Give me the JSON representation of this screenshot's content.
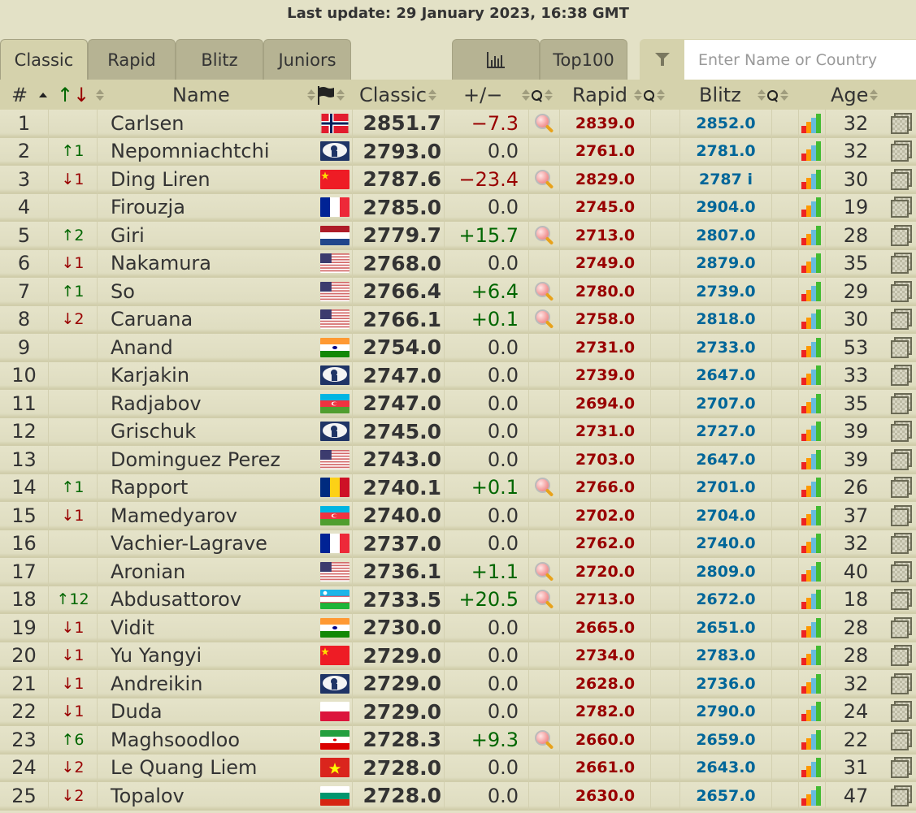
{
  "header": {
    "last_update": "Last update: 29 January 2023, 16:38 GMT"
  },
  "tabs": [
    {
      "label": "Classic",
      "active": true
    },
    {
      "label": "Rapid",
      "active": false
    },
    {
      "label": "Blitz",
      "active": false
    },
    {
      "label": "Juniors",
      "active": false
    }
  ],
  "right_tabs": {
    "chart_icon": "bar-chart-icon",
    "top100_label": "Top100"
  },
  "search": {
    "placeholder": "Enter Name or Country",
    "value": "",
    "icon": "filter-icon"
  },
  "columns": {
    "rank": "#",
    "change": "↑↓",
    "name": "Name",
    "flag_icon": "flag-icon",
    "classic": "Classic",
    "diff": "+/−",
    "rapid": "Rapid",
    "blitz": "Blitz",
    "age": "Age"
  },
  "colors": {
    "rapid": "#990000",
    "blitz": "#006699",
    "up": "#006600",
    "down": "#990000"
  },
  "players": [
    {
      "rank": "1",
      "change": "",
      "dir": "",
      "name": "Carlsen",
      "country": "Norway",
      "classic": "2851.7",
      "diff": "−7.3",
      "sign": "neg",
      "rapid": "2839.0",
      "blitz": "2852.0",
      "age": "32"
    },
    {
      "rank": "2",
      "change": "↑1",
      "dir": "up",
      "name": "Nepomniachtchi",
      "country": "FIDE",
      "classic": "2793.0",
      "diff": "0.0",
      "sign": "zero",
      "rapid": "2761.0",
      "blitz": "2781.0",
      "age": "32"
    },
    {
      "rank": "3",
      "change": "↓1",
      "dir": "down",
      "name": "Ding Liren",
      "country": "China",
      "classic": "2787.6",
      "diff": "−23.4",
      "sign": "neg",
      "rapid": "2829.0",
      "blitz": "2787 i",
      "age": "30"
    },
    {
      "rank": "4",
      "change": "",
      "dir": "",
      "name": "Firouzja",
      "country": "France",
      "classic": "2785.0",
      "diff": "0.0",
      "sign": "zero",
      "rapid": "2745.0",
      "blitz": "2904.0",
      "age": "19"
    },
    {
      "rank": "5",
      "change": "↑2",
      "dir": "up",
      "name": "Giri",
      "country": "Netherlands",
      "classic": "2779.7",
      "diff": "+15.7",
      "sign": "pos",
      "rapid": "2713.0",
      "blitz": "2807.0",
      "age": "28"
    },
    {
      "rank": "6",
      "change": "↓1",
      "dir": "down",
      "name": "Nakamura",
      "country": "USA",
      "classic": "2768.0",
      "diff": "0.0",
      "sign": "zero",
      "rapid": "2749.0",
      "blitz": "2879.0",
      "age": "35"
    },
    {
      "rank": "7",
      "change": "↑1",
      "dir": "up",
      "name": "So",
      "country": "USA",
      "classic": "2766.4",
      "diff": "+6.4",
      "sign": "pos",
      "rapid": "2780.0",
      "blitz": "2739.0",
      "age": "29"
    },
    {
      "rank": "8",
      "change": "↓2",
      "dir": "down",
      "name": "Caruana",
      "country": "USA",
      "classic": "2766.1",
      "diff": "+0.1",
      "sign": "pos",
      "rapid": "2758.0",
      "blitz": "2818.0",
      "age": "30"
    },
    {
      "rank": "9",
      "change": "",
      "dir": "",
      "name": "Anand",
      "country": "India",
      "classic": "2754.0",
      "diff": "0.0",
      "sign": "zero",
      "rapid": "2731.0",
      "blitz": "2733.0",
      "age": "53"
    },
    {
      "rank": "10",
      "change": "",
      "dir": "",
      "name": "Karjakin",
      "country": "FIDE",
      "classic": "2747.0",
      "diff": "0.0",
      "sign": "zero",
      "rapid": "2739.0",
      "blitz": "2647.0",
      "age": "33"
    },
    {
      "rank": "11",
      "change": "",
      "dir": "",
      "name": "Radjabov",
      "country": "Azerbaijan",
      "classic": "2747.0",
      "diff": "0.0",
      "sign": "zero",
      "rapid": "2694.0",
      "blitz": "2707.0",
      "age": "35"
    },
    {
      "rank": "12",
      "change": "",
      "dir": "",
      "name": "Grischuk",
      "country": "FIDE",
      "classic": "2745.0",
      "diff": "0.0",
      "sign": "zero",
      "rapid": "2731.0",
      "blitz": "2727.0",
      "age": "39"
    },
    {
      "rank": "13",
      "change": "",
      "dir": "",
      "name": "Dominguez Perez",
      "country": "USA",
      "classic": "2743.0",
      "diff": "0.0",
      "sign": "zero",
      "rapid": "2703.0",
      "blitz": "2647.0",
      "age": "39"
    },
    {
      "rank": "14",
      "change": "↑1",
      "dir": "up",
      "name": "Rapport",
      "country": "Romania",
      "classic": "2740.1",
      "diff": "+0.1",
      "sign": "pos",
      "rapid": "2766.0",
      "blitz": "2701.0",
      "age": "26"
    },
    {
      "rank": "15",
      "change": "↓1",
      "dir": "down",
      "name": "Mamedyarov",
      "country": "Azerbaijan",
      "classic": "2740.0",
      "diff": "0.0",
      "sign": "zero",
      "rapid": "2702.0",
      "blitz": "2704.0",
      "age": "37"
    },
    {
      "rank": "16",
      "change": "",
      "dir": "",
      "name": "Vachier-Lagrave",
      "country": "France",
      "classic": "2737.0",
      "diff": "0.0",
      "sign": "zero",
      "rapid": "2762.0",
      "blitz": "2740.0",
      "age": "32"
    },
    {
      "rank": "17",
      "change": "",
      "dir": "",
      "name": "Aronian",
      "country": "USA",
      "classic": "2736.1",
      "diff": "+1.1",
      "sign": "pos",
      "rapid": "2720.0",
      "blitz": "2809.0",
      "age": "40"
    },
    {
      "rank": "18",
      "change": "↑12",
      "dir": "up",
      "name": "Abdusattorov",
      "country": "Uzbekistan",
      "classic": "2733.5",
      "diff": "+20.5",
      "sign": "pos",
      "rapid": "2713.0",
      "blitz": "2672.0",
      "age": "18"
    },
    {
      "rank": "19",
      "change": "↓1",
      "dir": "down",
      "name": "Vidit",
      "country": "India",
      "classic": "2730.0",
      "diff": "0.0",
      "sign": "zero",
      "rapid": "2665.0",
      "blitz": "2651.0",
      "age": "28"
    },
    {
      "rank": "20",
      "change": "↓1",
      "dir": "down",
      "name": "Yu Yangyi",
      "country": "China",
      "classic": "2729.0",
      "diff": "0.0",
      "sign": "zero",
      "rapid": "2734.0",
      "blitz": "2783.0",
      "age": "28"
    },
    {
      "rank": "21",
      "change": "↓1",
      "dir": "down",
      "name": "Andreikin",
      "country": "FIDE",
      "classic": "2729.0",
      "diff": "0.0",
      "sign": "zero",
      "rapid": "2628.0",
      "blitz": "2736.0",
      "age": "32"
    },
    {
      "rank": "22",
      "change": "↓1",
      "dir": "down",
      "name": "Duda",
      "country": "Poland",
      "classic": "2729.0",
      "diff": "0.0",
      "sign": "zero",
      "rapid": "2782.0",
      "blitz": "2790.0",
      "age": "24"
    },
    {
      "rank": "23",
      "change": "↑6",
      "dir": "up",
      "name": "Maghsoodloo",
      "country": "Iran",
      "classic": "2728.3",
      "diff": "+9.3",
      "sign": "pos",
      "rapid": "2660.0",
      "blitz": "2659.0",
      "age": "22"
    },
    {
      "rank": "24",
      "change": "↓2",
      "dir": "down",
      "name": "Le Quang Liem",
      "country": "Vietnam",
      "classic": "2728.0",
      "diff": "0.0",
      "sign": "zero",
      "rapid": "2661.0",
      "blitz": "2643.0",
      "age": "31"
    },
    {
      "rank": "25",
      "change": "↓2",
      "dir": "down",
      "name": "Topalov",
      "country": "Bulgaria",
      "classic": "2728.0",
      "diff": "0.0",
      "sign": "zero",
      "rapid": "2630.0",
      "blitz": "2657.0",
      "age": "47"
    }
  ]
}
